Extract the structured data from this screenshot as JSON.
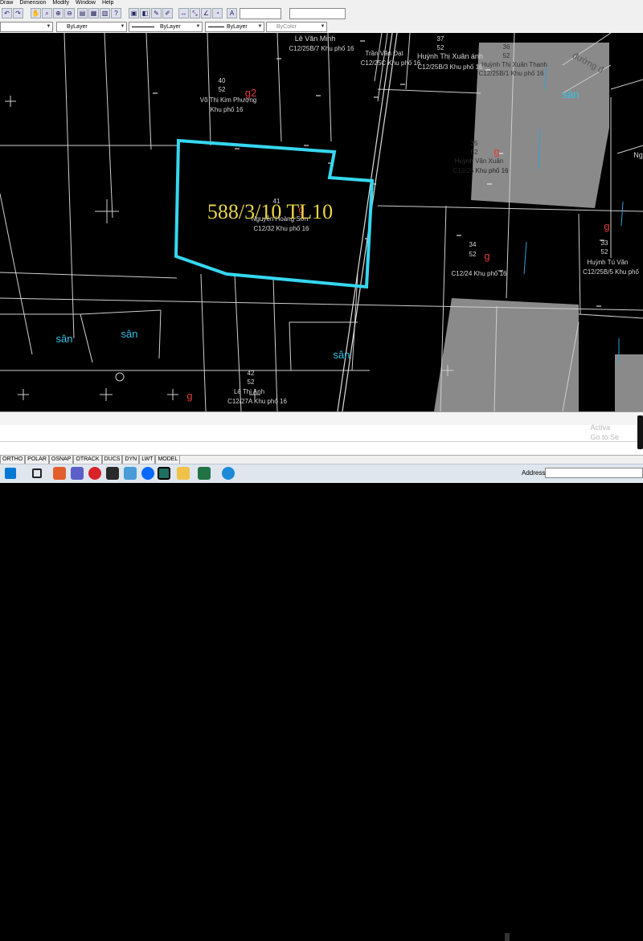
{
  "menu": [
    "Draw",
    "Dimension",
    "Modify",
    "Window",
    "Help"
  ],
  "toolbar2": {
    "layer_value": "ByLayer",
    "linetype_value": "ByLayer",
    "lineweight_value": "ByLayer",
    "color_value": "ByColor"
  },
  "statusbar": [
    "ORTHO",
    "POLAR",
    "OSNAP",
    "OTRACK",
    "DUCS",
    "DYN",
    "LWT",
    "MODEL"
  ],
  "watermark": [
    "Activa",
    "Go to Se"
  ],
  "taskbar": {
    "address_label": "Address"
  },
  "drawing": {
    "highlight_label": "588/3/10 TL10",
    "highlight_color": "#36d7f0",
    "road_label": "đường đ",
    "san_labels": [
      "sân",
      "sân",
      "sân",
      "sân"
    ],
    "g_labels": [
      "g2",
      "g",
      "g",
      "g",
      "g",
      "g"
    ],
    "lot_le_van_minh": "Lê Văn Minh",
    "lot_le_van_minh_sub": "C12/25B/7  Khu phố 16",
    "lot_37_num": "37",
    "lot_37_sheet": "52",
    "lot_tran_van_dat": "Trần Văn Đạt",
    "lot_tran_van_dat_sub": "C12/25C  Khu phố 16",
    "lot_huynh_xuan_anh": "Huỳnh Thị Xuân ánh",
    "lot_huynh_xuan_anh_sub": "C12/25B/3  Khu phố 16",
    "lot_36_num": "36",
    "lot_36_sheet": "52",
    "lot_huynh_xuan_thanh": "Huỳnh Thị Xuân Thanh",
    "lot_huynh_xuan_thanh_sub": "C12/25B/1  Khu phố 16",
    "lot_40_num": "40",
    "lot_40_sheet": "52",
    "lot_vo_kim_phuong": "Võ Thị Kim Phượng",
    "lot_vo_kim_phuong_sub": "Khu phố 16",
    "lot_35_num": "35",
    "lot_35_sheet": "52",
    "lot_huynh_van_xuan": "Huỳnh Văn Xuân",
    "lot_huynh_van_xuan_sub": "C12/25  Khu phố 16",
    "lot_41_num": "41",
    "lot_nguyen_hoang_son": "Nguyễn Hoàng Sơn",
    "lot_nguyen_hoang_son_sub": "C12/32  Khu phố 16",
    "lot_34_num": "34",
    "lot_34_sheet": "52",
    "lot_34_sub": "C12/24  Khu phố 16",
    "lot_33_num": "33",
    "lot_33_sheet": "52",
    "lot_huynh_tu_van": "Huỳnh Tú Văn",
    "lot_huynh_tu_van_sub": "C12/25B/5  Khu phố",
    "lot_42_num": "42",
    "lot_42_sheet": "52",
    "lot_le_thi_anh": "Lê Thị Anh",
    "lot_le_thi_anh_sub": "C12/27A  Khu phố 16",
    "edge_ng": "Ng"
  }
}
